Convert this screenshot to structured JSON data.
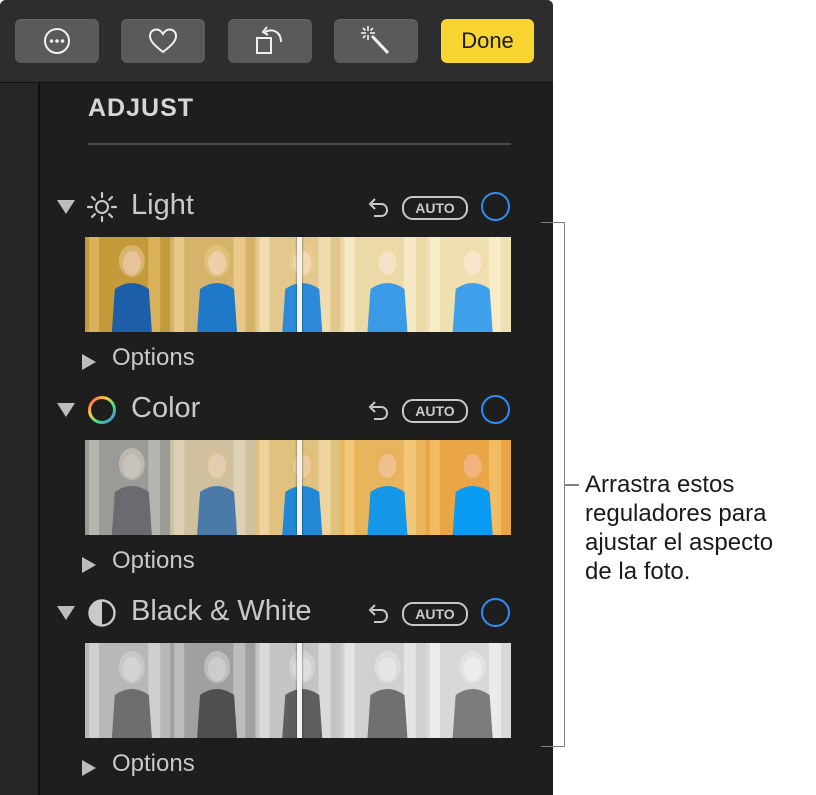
{
  "toolbar": {
    "buttons": [
      {
        "name": "more-options",
        "icon": "ellipsis-circle-icon"
      },
      {
        "name": "favorite",
        "icon": "heart-icon"
      },
      {
        "name": "rotate",
        "icon": "rotate-icon"
      },
      {
        "name": "enhance",
        "icon": "magic-wand-icon"
      }
    ],
    "done_label": "Done",
    "done_color": "#f9d531"
  },
  "panel": {
    "title": "ADJUST"
  },
  "sections": [
    {
      "label": "Light",
      "icon": "sun-icon",
      "auto_label": "AUTO",
      "options_label": "Options",
      "palette": "warm"
    },
    {
      "label": "Color",
      "icon": "color-wheel-icon",
      "auto_label": "AUTO",
      "options_label": "Options",
      "palette": "saturation"
    },
    {
      "label": "Black & White",
      "icon": "half-circle-icon",
      "auto_label": "AUTO",
      "options_label": "Options",
      "palette": "mono"
    }
  ],
  "callout": {
    "lines": [
      "Arrastra estos",
      "reguladores para",
      "ajustar el aspecto",
      "de la foto."
    ]
  },
  "colors": {
    "panel_bg": "#1e1e1e",
    "accent_blue": "#2f8df5",
    "text": "#c9c9c9"
  }
}
